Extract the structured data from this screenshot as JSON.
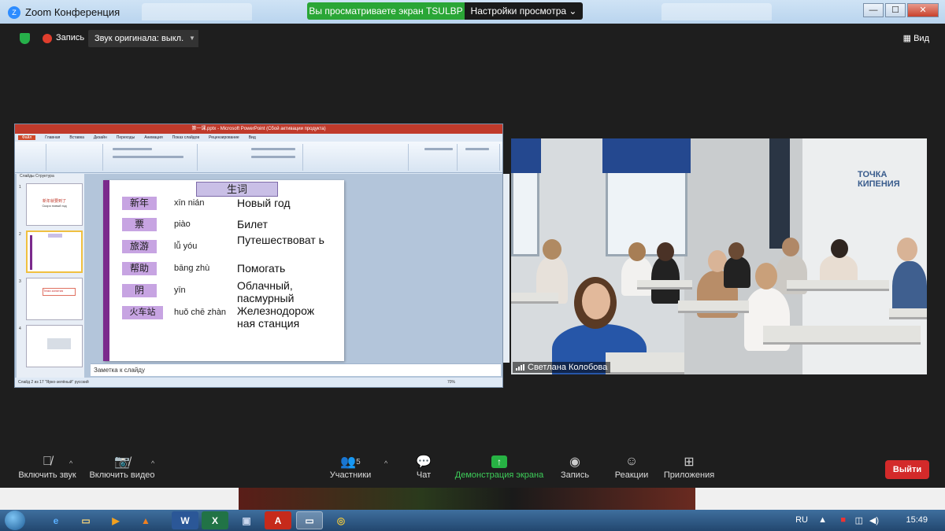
{
  "window": {
    "title": "Zoom Конференция",
    "minimize_glyph": "—",
    "maximize_glyph": "☐",
    "close_glyph": "✕"
  },
  "share_banner": {
    "status": "Вы просматриваете экран TSULBP",
    "view_settings": "Настройки просмотра ⌄"
  },
  "top_bar": {
    "recording": "Запись",
    "original_sound": "Звук оригинала: выкл.",
    "view": "Вид"
  },
  "powerpoint": {
    "title": "第一课.pptx - Microsoft PowerPoint (Сбой активации продукта)",
    "file_tab": "Файл",
    "tabs": [
      "Главная",
      "Вставка",
      "Дизайн",
      "Переходы",
      "Анимация",
      "Показ слайдов",
      "Рецензирование",
      "Вид"
    ],
    "thumbs_tabs": "Слайды   Структура",
    "notes_placeholder": "Заметка к слайду",
    "status": "Слайд 2 из 17     \"Ярко-зелёный\"     русский",
    "zoom": "70%",
    "slide": {
      "title": "生词",
      "vocab": [
        {
          "cn": "新年",
          "pinyin": "xīn nián",
          "ru": "Новый год"
        },
        {
          "cn": "票",
          "pinyin": "piào",
          "ru": "Билет"
        },
        {
          "cn": "旅游",
          "pinyin": "lǚ yóu",
          "ru": "Путешествоват ь"
        },
        {
          "cn": "帮助",
          "pinyin": "bāng zhù",
          "ru": "Помогать"
        },
        {
          "cn": "阴",
          "pinyin": "yīn",
          "ru": "Облачный, пасмурный"
        },
        {
          "cn": "火车站",
          "pinyin": "huǒ chē zhàn",
          "ru": "Железнодорож ная станция"
        }
      ]
    },
    "thumb1_line1": "新年就要到了",
    "thumb1_line2": "Скоро новый год",
    "thumb3_label": "Тема занятия"
  },
  "video": {
    "participant_name": "Светлана Колобова",
    "wall_logo": "ТОЧКА КИПЕНИЯ"
  },
  "toolbar": {
    "unmute": "Включить звук",
    "start_video": "Включить видео",
    "participants": "Участники",
    "participants_count": "5",
    "chat": "Чат",
    "share_screen": "Демонстрация экрана",
    "record": "Запись",
    "reactions": "Реакции",
    "apps": "Приложения",
    "leave": "Выйти"
  },
  "taskbar": {
    "language": "RU",
    "time": "15:49",
    "apps": [
      "ie",
      "explorer",
      "media",
      "vlc",
      "word",
      "excel",
      "save",
      "acrobat",
      "zoom",
      "chrome"
    ]
  },
  "colors": {
    "accent_green": "#2aa636",
    "leave_red": "#d32a2a",
    "slide_border": "#7b2a8c",
    "vocab_chip": "#c7a4e2"
  }
}
